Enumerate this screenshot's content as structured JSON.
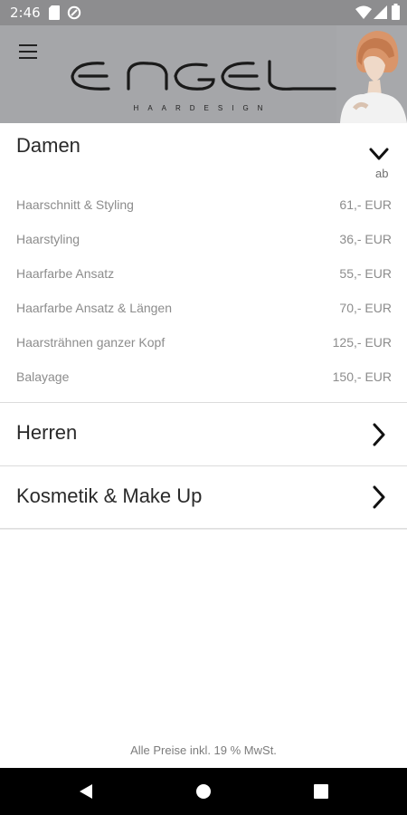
{
  "status_bar": {
    "time": "2:46",
    "left_icons": [
      "sd-card-icon",
      "data-saver-icon"
    ],
    "right_icons": [
      "wifi-icon",
      "signal-icon",
      "battery-icon"
    ],
    "background": "#8d8d8f"
  },
  "header": {
    "brand": "ENGEL",
    "brand_sub": "HAARDESIGN",
    "background": "#a5a6a9"
  },
  "sections": [
    {
      "title": "Damen",
      "expanded": true,
      "price_hint": "ab",
      "items": [
        {
          "name": "Haarschnitt & Styling",
          "price": "61,- EUR"
        },
        {
          "name": "Haarstyling",
          "price": "36,- EUR"
        },
        {
          "name": "Haarfarbe Ansatz",
          "price": "55,- EUR"
        },
        {
          "name": "Haarfarbe Ansatz & Längen",
          "price": "70,- EUR"
        },
        {
          "name": "Haarsträhnen ganzer Kopf",
          "price": "125,- EUR"
        },
        {
          "name": "Balayage",
          "price": "150,- EUR"
        }
      ]
    },
    {
      "title": "Herren",
      "expanded": false
    },
    {
      "title": "Kosmetik & Make Up",
      "expanded": false
    }
  ],
  "footer": {
    "note": "Alle Preise inkl. 19 % MwSt."
  },
  "nav_bar": {
    "buttons": [
      "back-icon",
      "home-icon",
      "recents-icon"
    ]
  }
}
